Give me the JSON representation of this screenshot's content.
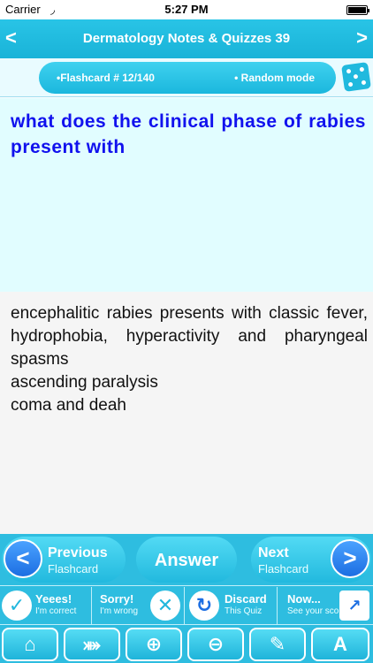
{
  "status_bar": {
    "carrier": "Carrier",
    "wifi_icon": "◞",
    "time": "5:27 PM"
  },
  "nav": {
    "title": "Dermatology Notes & Quizzes 39",
    "back_icon": "<",
    "forward_icon": ">"
  },
  "info": {
    "flashcard_counter": "•Flashcard #  12/140",
    "mode": "•  Random mode",
    "dice_icon": "dice-icon"
  },
  "question": {
    "text": "what does the clinical phase of rabies present with"
  },
  "answer": {
    "lines": [
      "encephalitic rabies presents with classic fever, hydrophobia, hyperactivity and pharyngeal spasms",
      "ascending paralysis",
      "coma and deah"
    ]
  },
  "nav_buttons": {
    "previous_big": "Previous",
    "previous_small": "Flashcard",
    "answer": "Answer",
    "next_big": "Next",
    "next_small": "Flashcard",
    "left_arrow": "<",
    "right_arrow": ">"
  },
  "quiz_buttons": {
    "correct_title": "Yeees!",
    "correct_sub": "I'm correct",
    "correct_icon": "✓",
    "wrong_title": "Sorry!",
    "wrong_sub": "I'm wrong",
    "wrong_icon": "✕",
    "discard_title": "Discard",
    "discard_sub": "This Quiz",
    "discard_icon": "↻",
    "score_title": "Now...",
    "score_sub": "See your score",
    "score_icon": "↗"
  },
  "toolbar": {
    "home_icon": "⌂",
    "share_icon": "⤘",
    "zoom_in_icon": "⊕",
    "zoom_out_icon": "⊖",
    "highlight_icon": "✎",
    "font_icon": "A"
  },
  "colors": {
    "accent": "#2ebde0",
    "question_text": "#1111ee",
    "question_bg": "#e1fdff",
    "answer_bg": "#f5f5f5"
  }
}
